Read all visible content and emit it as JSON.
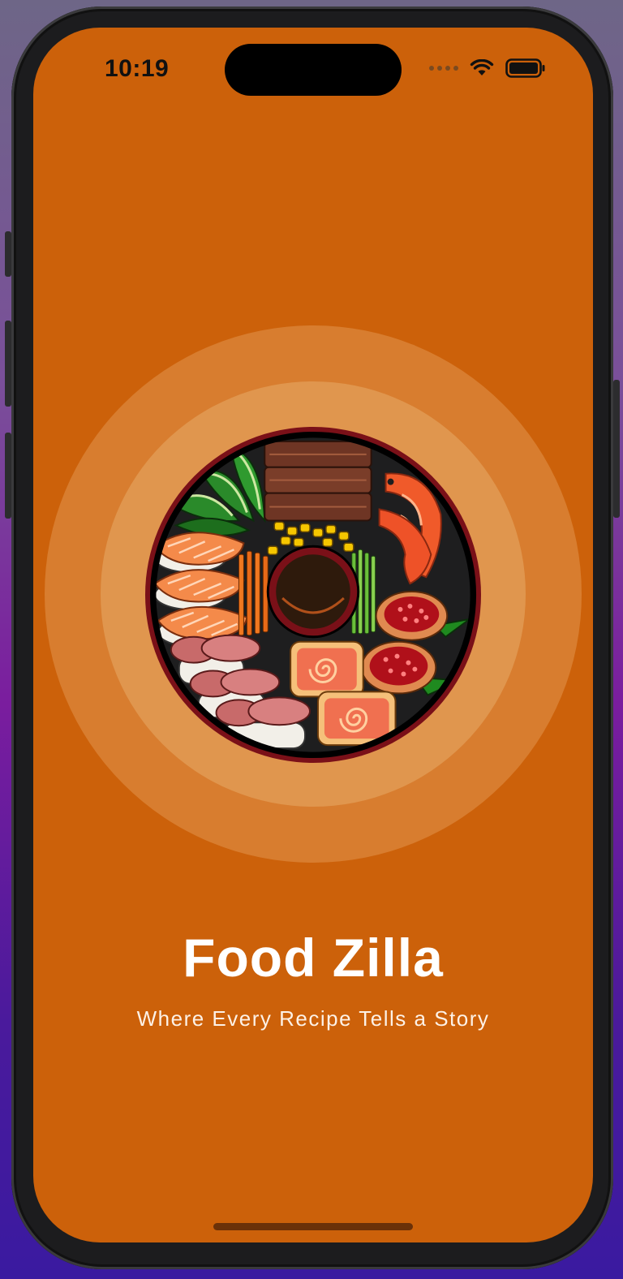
{
  "status_bar": {
    "time": "10:19",
    "icons": [
      "cellular-signal-icon",
      "wifi-icon",
      "battery-icon"
    ]
  },
  "splash": {
    "illustration": "food-platter-illustration",
    "title": "Food Zilla",
    "tagline": "Where Every Recipe Tells a Story"
  },
  "colors": {
    "background": "#cc610a",
    "ring_outer": "#d87d2f",
    "ring_inner": "#e0964e",
    "title_text": "#ffffff",
    "device_backdrop_top": "#6e6687",
    "device_backdrop_bottom": "#3a1aa0"
  }
}
